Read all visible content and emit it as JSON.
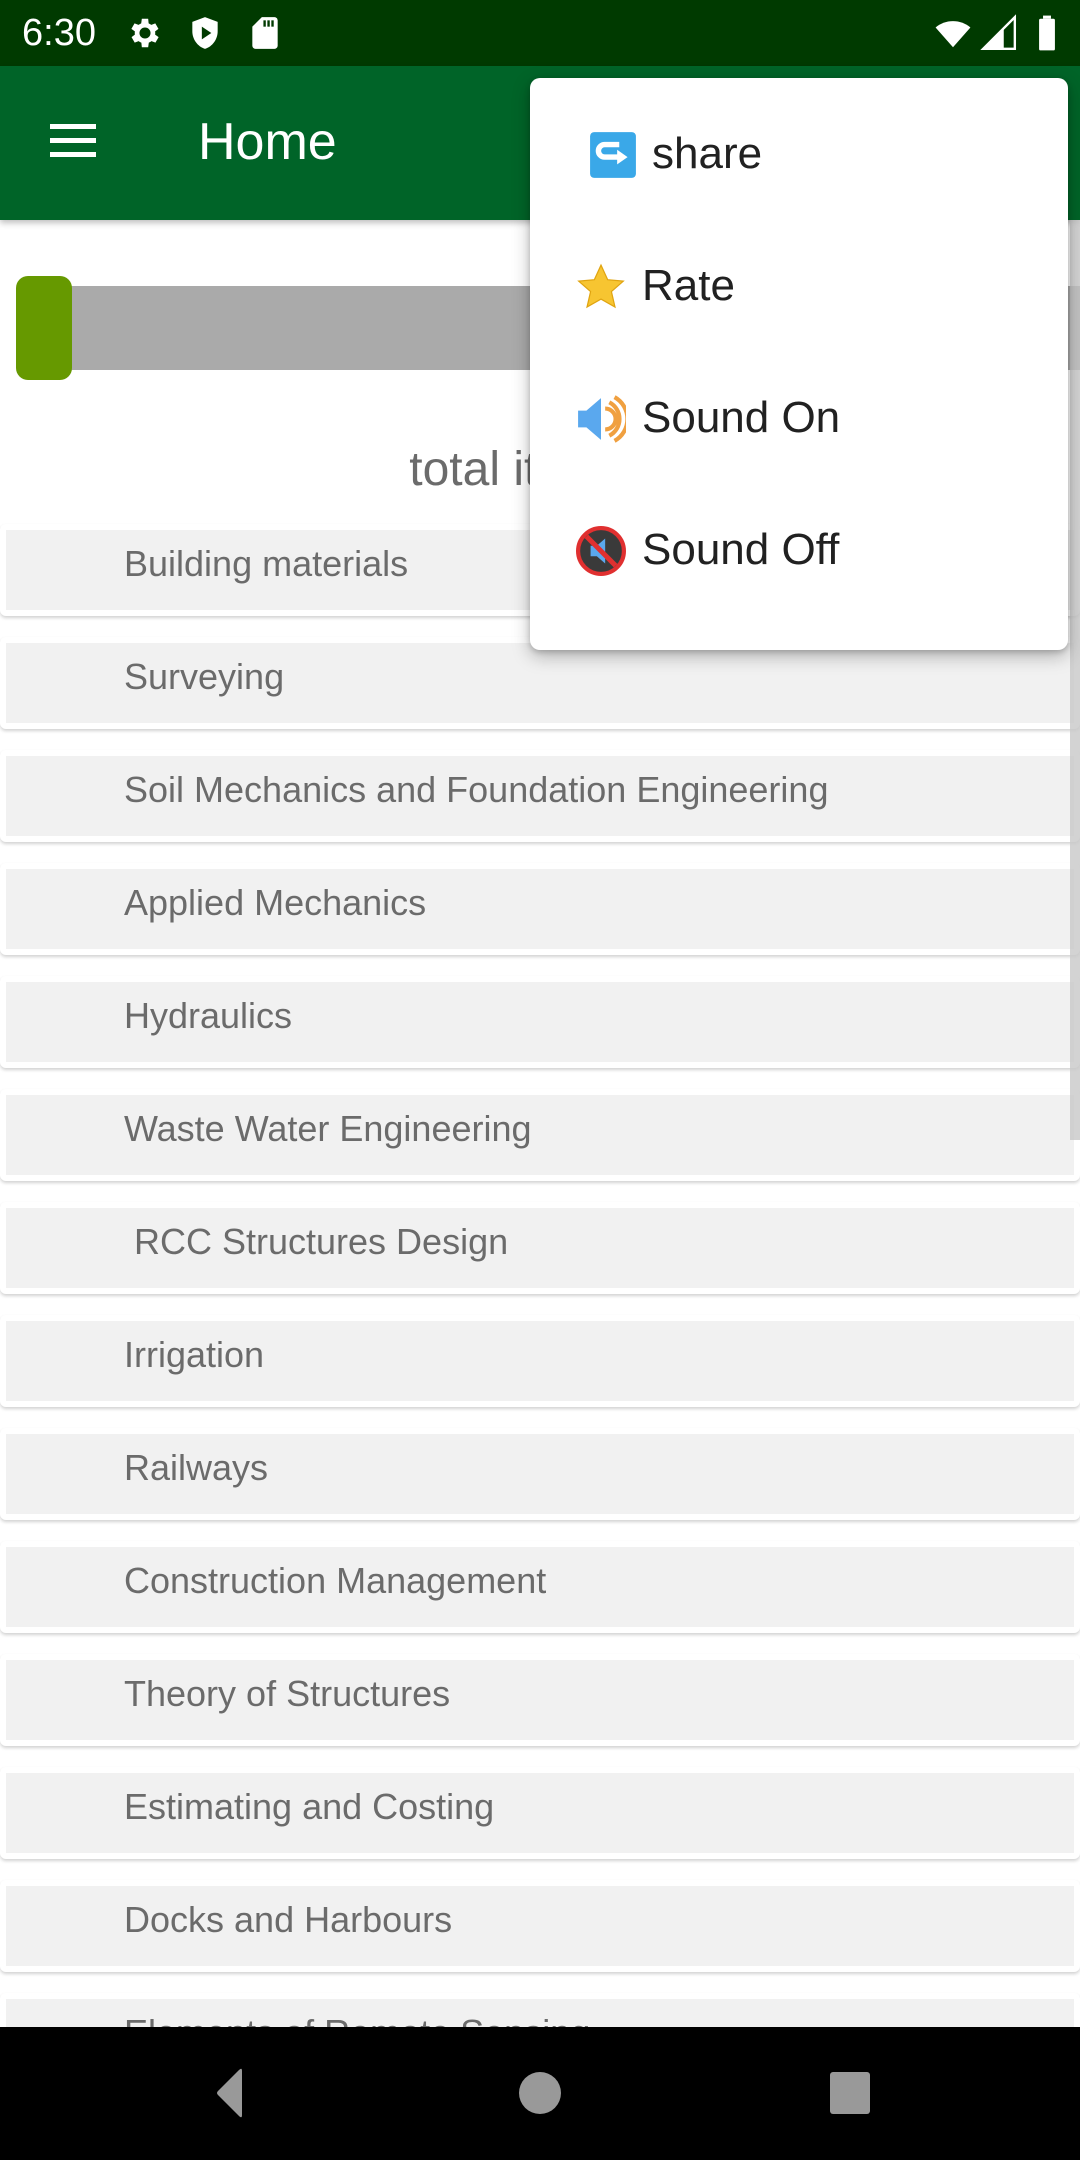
{
  "status_bar": {
    "time": "6:30",
    "left_icons": [
      "gear-icon",
      "shield-play-icon",
      "sd-card-icon"
    ],
    "right_icons": [
      "wifi-icon",
      "signal-icon",
      "battery-icon"
    ]
  },
  "app_bar": {
    "title": "Home",
    "menu_icon": "hamburger-icon",
    "color": "#006428"
  },
  "progress": {
    "value_fraction": 0.05,
    "fill_color": "#669900",
    "track_color": "#aaaaaa"
  },
  "total_label": "total item qu",
  "list": {
    "items": [
      {
        "label": "Building materials"
      },
      {
        "label": "Surveying"
      },
      {
        "label": "Soil Mechanics and Foundation Engineering"
      },
      {
        "label": "Applied Mechanics"
      },
      {
        "label": "Hydraulics"
      },
      {
        "label": "Waste Water Engineering"
      },
      {
        "label": " RCC Structures Design"
      },
      {
        "label": "Irrigation"
      },
      {
        "label": "Railways"
      },
      {
        "label": "Construction Management"
      },
      {
        "label": "Theory of Structures"
      },
      {
        "label": "Estimating and Costing"
      },
      {
        "label": "Docks and Harbours"
      },
      {
        "label": "Elements of Remote Sensing"
      }
    ]
  },
  "overflow_menu": {
    "items": [
      {
        "label": "share",
        "icon": "share-arrow-icon"
      },
      {
        "label": "Rate",
        "icon": "star-icon"
      },
      {
        "label": "Sound On",
        "icon": "speaker-on-icon"
      },
      {
        "label": "Sound Off",
        "icon": "speaker-muted-icon"
      }
    ]
  },
  "nav_bar": {
    "buttons": [
      "back",
      "home",
      "recents"
    ]
  }
}
